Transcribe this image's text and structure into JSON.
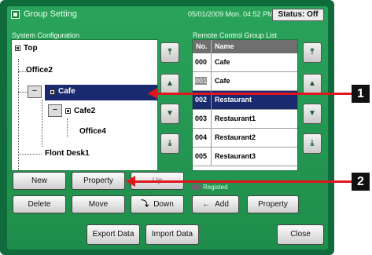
{
  "window": {
    "title": "Group Setting",
    "datetime": "05/01/2009 Mon. 04:52 PM",
    "status": "Status: Off"
  },
  "system_config": {
    "label": "System Configuration",
    "tree": [
      {
        "label": "Top"
      },
      {
        "label": "Office2"
      },
      {
        "label": "Cafe",
        "selected": true
      },
      {
        "label": "Cafe2"
      },
      {
        "label": "Office4"
      },
      {
        "label": "Flont Desk1"
      }
    ],
    "collapse_glyph": "−",
    "scroll": [
      "⤒",
      "▲",
      "▼",
      "⤓"
    ]
  },
  "remote_list": {
    "label": "Remote Control Group List",
    "col_no": "No.",
    "col_name": "Name",
    "rows": [
      {
        "no": "000",
        "name": "Cafe"
      },
      {
        "no": "001",
        "name": "Cafe"
      },
      {
        "no": "002",
        "name": "Restaurant"
      },
      {
        "no": "003",
        "name": "Restaurant1"
      },
      {
        "no": "004",
        "name": "Restaurant2"
      },
      {
        "no": "005",
        "name": "Restaurant3"
      }
    ],
    "registered_label": "Registed"
  },
  "left_buttons": {
    "new": "New",
    "property": "Property",
    "up": "Up",
    "delete": "Delete",
    "move": "Move",
    "down": "Down"
  },
  "right_buttons": {
    "add": "Add",
    "property": "Property"
  },
  "bottom_buttons": {
    "export": "Export Data",
    "import": "Import Data",
    "close": "Close"
  },
  "callouts": [
    "1",
    "2"
  ],
  "colors": {
    "screen_bg": "#2aa35a",
    "selection": "#1a2a6e",
    "callout": "#e0161f"
  }
}
